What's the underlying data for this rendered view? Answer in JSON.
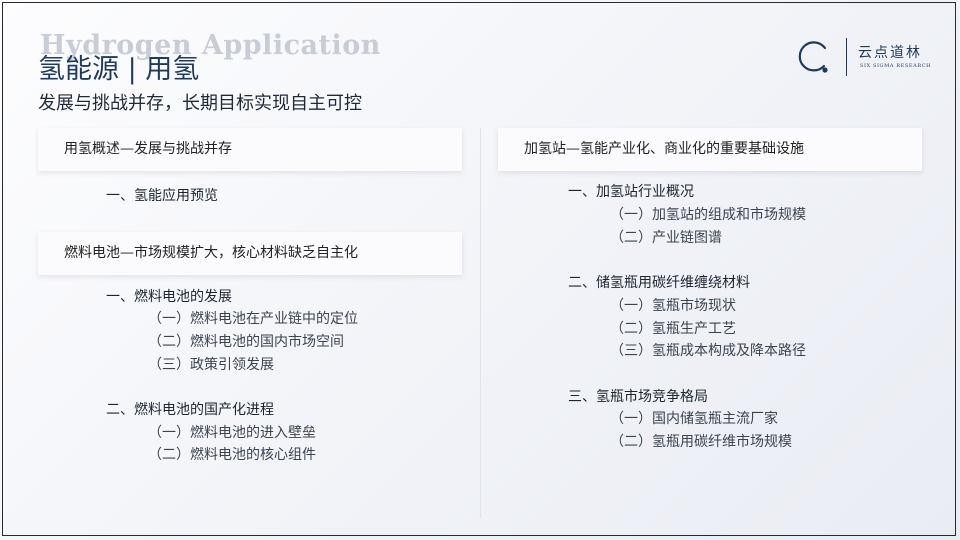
{
  "header": {
    "watermark": "Hydrogen Application",
    "title": "氢能源 | 用氢",
    "subtitle": "发展与挑战并存，长期目标实现自主可控"
  },
  "logo": {
    "name_cn": "云点道林",
    "name_en": "SIX SIGMA RESEARCH"
  },
  "left_column": {
    "sections": [
      {
        "header": "用氢概述—发展与挑战并存",
        "groups": [
          {
            "title": "一、氢能应用预览",
            "items": []
          }
        ]
      },
      {
        "header": "燃料电池—市场规模扩大，核心材料缺乏自主化",
        "groups": [
          {
            "title": "一、燃料电池的发展",
            "items": [
              "（一）燃料电池在产业链中的定位",
              "（二）燃料电池的国内市场空间",
              "（三）政策引领发展"
            ]
          },
          {
            "title": "二、燃料电池的国产化进程",
            "items": [
              "（一）燃料电池的进入壁垒",
              "（二）燃料电池的核心组件"
            ]
          }
        ]
      }
    ]
  },
  "right_column": {
    "sections": [
      {
        "header": "加氢站—氢能产业化、商业化的重要基础设施",
        "groups": [
          {
            "title": "一、加氢站行业概况",
            "items": [
              "（一）加氢站的组成和市场规模",
              "（二）产业链图谱"
            ]
          },
          {
            "title": "二、储氢瓶用碳纤维缠绕材料",
            "items": [
              "（一）氢瓶市场现状",
              "（二）氢瓶生产工艺",
              "（三）氢瓶成本构成及降本路径"
            ]
          },
          {
            "title": "三、氢瓶市场竞争格局",
            "items": [
              "（一）国内储氢瓶主流厂家",
              "（二）氢瓶用碳纤维市场规模"
            ]
          }
        ]
      }
    ]
  }
}
